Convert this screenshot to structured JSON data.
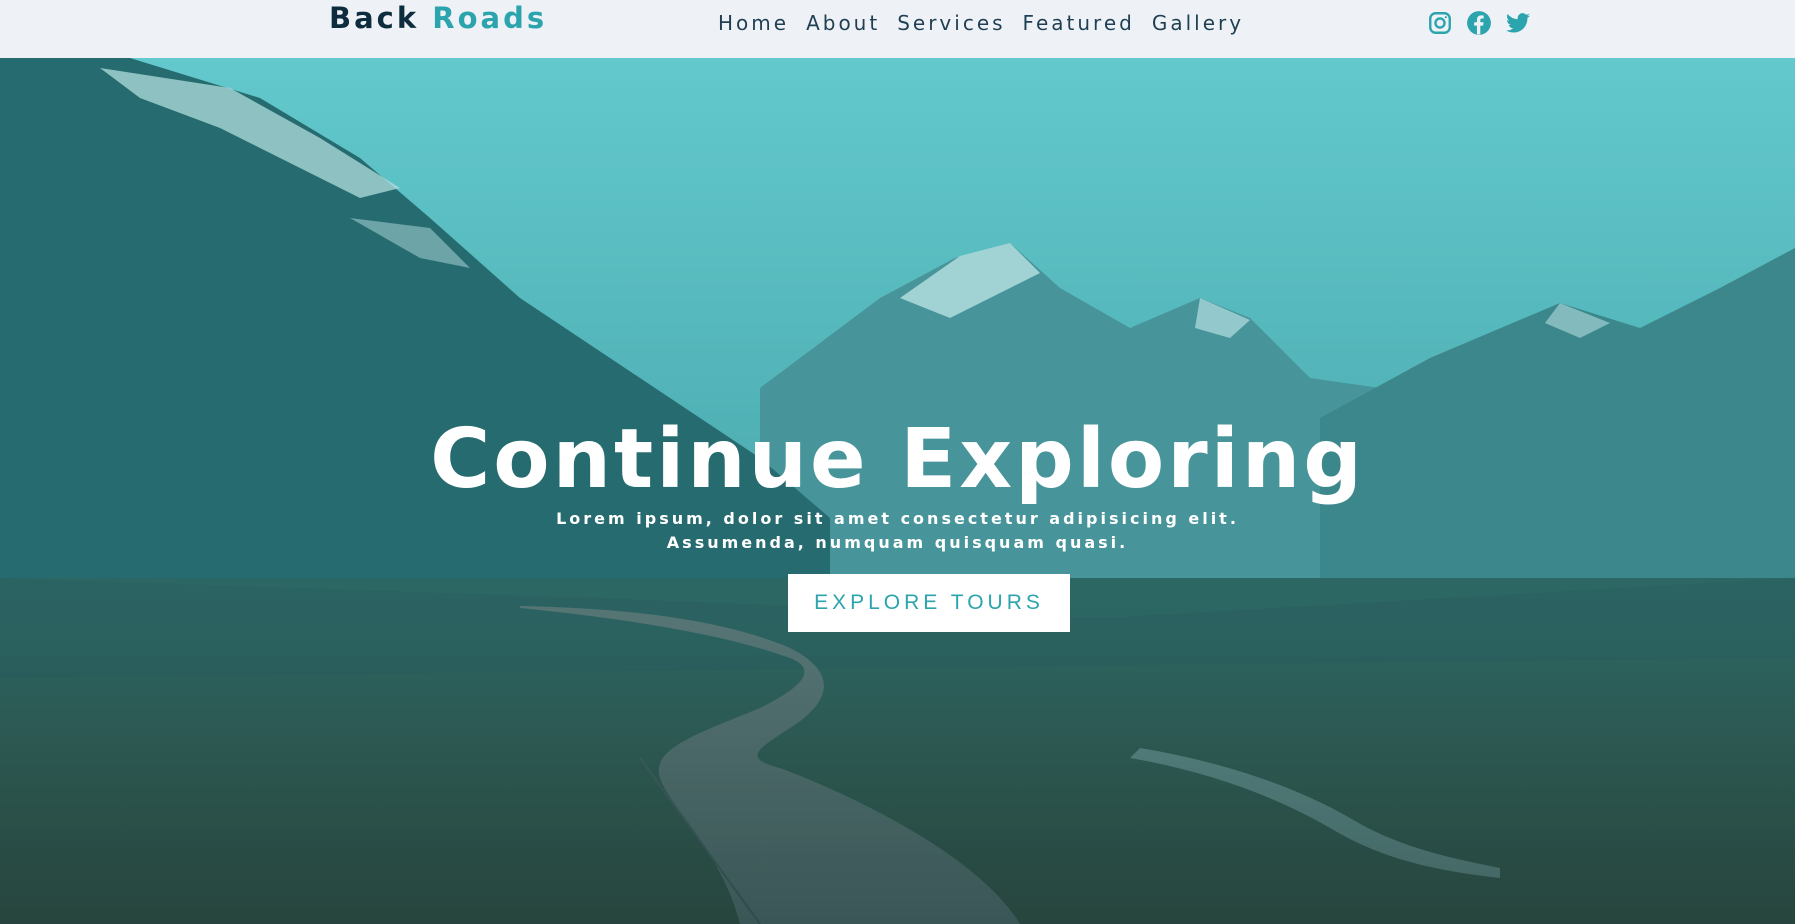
{
  "brand": {
    "first": "Back",
    "second": "Roads",
    "accent_color": "#2ba4ad",
    "text_color": "#0d2d3e"
  },
  "nav": {
    "links": [
      {
        "label": "Home"
      },
      {
        "label": "About"
      },
      {
        "label": "Services"
      },
      {
        "label": "Featured"
      },
      {
        "label": "Gallery"
      }
    ]
  },
  "social": [
    {
      "icon": "instagram-icon"
    },
    {
      "icon": "facebook-icon"
    },
    {
      "icon": "twitter-icon"
    }
  ],
  "hero": {
    "title": "Continue Exploring",
    "text": "Lorem ipsum, dolor sit amet consectetur adipisicing elit. Assumenda, numquam quisquam quasi.",
    "button_label": "EXPLORE TOURS",
    "overlay_color": "#2ba4ad"
  }
}
